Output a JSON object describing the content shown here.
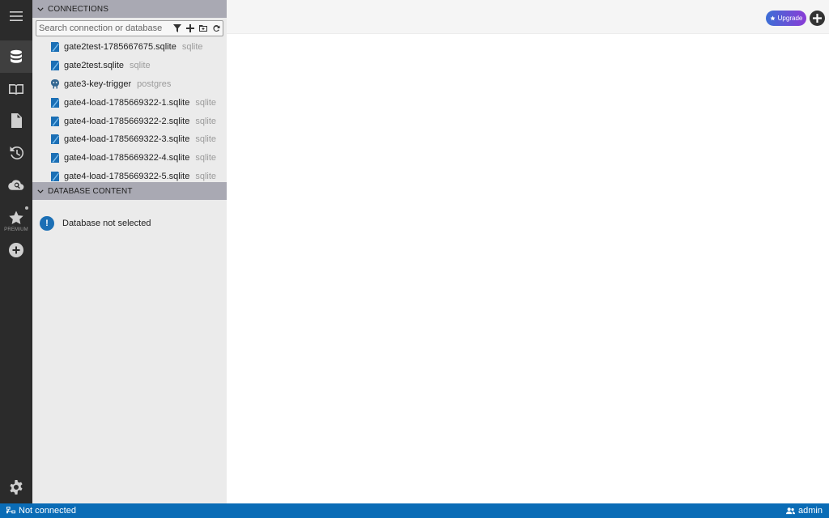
{
  "rail": {
    "items": [
      {
        "icon": "menu-icon"
      },
      {
        "icon": "database-icon",
        "active": true
      },
      {
        "icon": "book-icon"
      },
      {
        "icon": "file-icon"
      },
      {
        "icon": "history-icon"
      },
      {
        "icon": "cloud-search-icon"
      },
      {
        "icon": "star-icon"
      },
      {
        "icon": "add-circle-icon"
      },
      {
        "icon": "settings-icon"
      }
    ],
    "premium_label": "PREMIUM"
  },
  "connections": {
    "header": "CONNECTIONS",
    "search_placeholder": "Search connection or database",
    "items": [
      {
        "name": "gate2test-1785667675.sqlite",
        "type": "sqlite"
      },
      {
        "name": "gate2test.sqlite",
        "type": "sqlite"
      },
      {
        "name": "gate3-key-trigger",
        "type": "postgres"
      },
      {
        "name": "gate4-load-1785669322-1.sqlite",
        "type": "sqlite"
      },
      {
        "name": "gate4-load-1785669322-2.sqlite",
        "type": "sqlite"
      },
      {
        "name": "gate4-load-1785669322-3.sqlite",
        "type": "sqlite"
      },
      {
        "name": "gate4-load-1785669322-4.sqlite",
        "type": "sqlite"
      },
      {
        "name": "gate4-load-1785669322-5.sqlite",
        "type": "sqlite"
      }
    ]
  },
  "database_content": {
    "header": "DATABASE CONTENT",
    "notice": "Database not selected"
  },
  "topbar": {
    "upgrade_label": "Upgrade"
  },
  "statusbar": {
    "connection_status": "Not connected",
    "user": "admin"
  },
  "colors": {
    "accent": "#0a6cb6",
    "rail_bg": "#2b2b2b",
    "section_header": "#a9a9b3",
    "sqlite_icon": "#1b6fb5",
    "postgres_icon": "#336791"
  }
}
